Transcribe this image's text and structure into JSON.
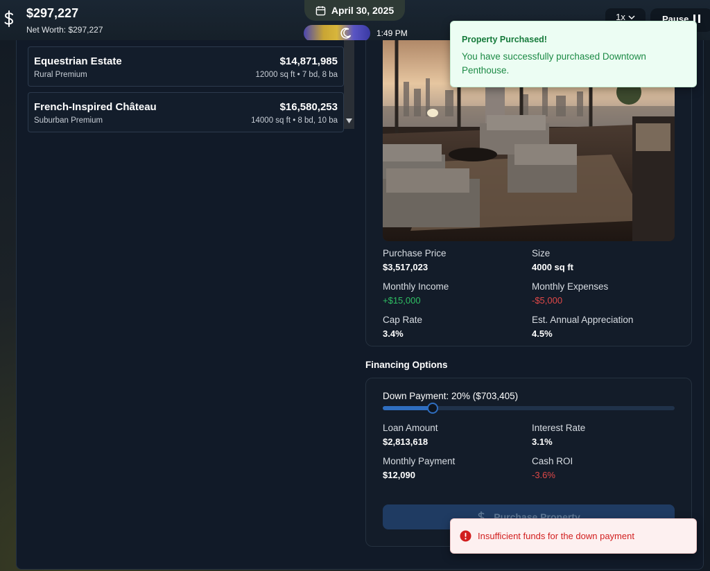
{
  "header": {
    "net_worth_amount": "$297,227",
    "net_worth_label": "Net Worth: $297,227",
    "date": "April 30, 2025",
    "time": "1:49 PM",
    "speed": "1x",
    "pause_label": "Pause"
  },
  "properties": [
    {
      "name": "Equestrian Estate",
      "price": "$14,871,985",
      "tier": "Rural Premium",
      "specs": "12000 sq ft • 7 bd, 8 ba"
    },
    {
      "name": "French-Inspired Château",
      "price": "$16,580,253",
      "tier": "Suburban Premium",
      "specs": "14000 sq ft • 8 bd, 10 ba"
    }
  ],
  "details": {
    "purchase_price_label": "Purchase Price",
    "purchase_price": "$3,517,023",
    "size_label": "Size",
    "size": "4000 sq ft",
    "monthly_income_label": "Monthly Income",
    "monthly_income": "+$15,000",
    "monthly_expenses_label": "Monthly Expenses",
    "monthly_expenses": "-$5,000",
    "cap_rate_label": "Cap Rate",
    "cap_rate": "3.4%",
    "appreciation_label": "Est. Annual Appreciation",
    "appreciation": "4.5%"
  },
  "financing": {
    "title": "Financing Options",
    "down_payment_label": "Down Payment: 20% ($703,405)",
    "down_payment_fraction": 0.17,
    "loan_amount_label": "Loan Amount",
    "loan_amount": "$2,813,618",
    "interest_rate_label": "Interest Rate",
    "interest_rate": "3.1%",
    "monthly_payment_label": "Monthly Payment",
    "monthly_payment": "$12,090",
    "cash_roi_label": "Cash ROI",
    "cash_roi": "-3.6%",
    "purchase_button": "Purchase Property"
  },
  "toasts": {
    "success_title": "Property Purchased!",
    "success_message": "You have successfully purchased Downtown Penthouse.",
    "error_message": "Insufficient funds for the down payment"
  },
  "colors": {
    "positive": "#2fbf63",
    "negative": "#e04848",
    "accent": "#2f6ec0"
  }
}
